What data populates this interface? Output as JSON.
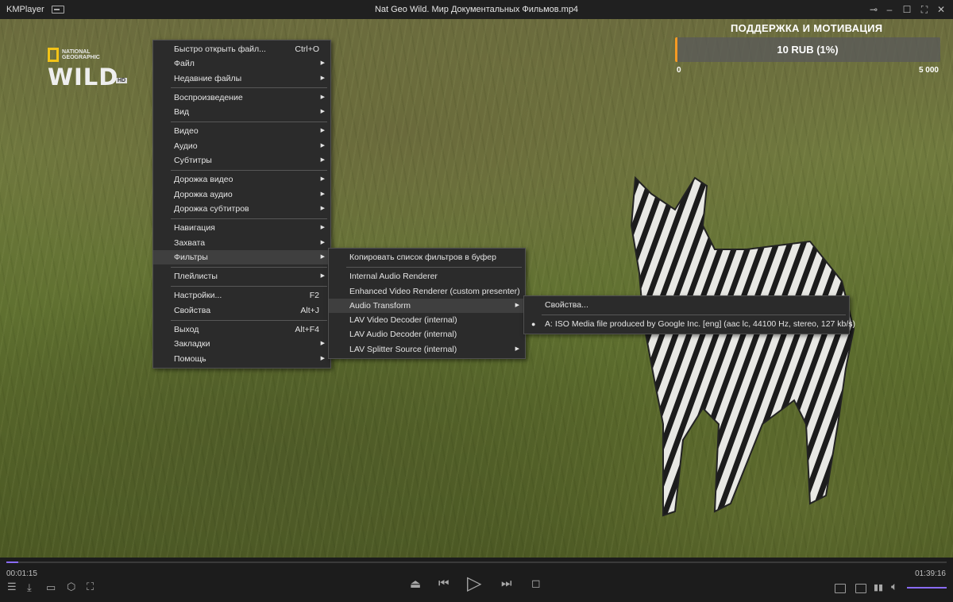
{
  "window": {
    "app_name": "KMPlayer",
    "title": "Nat Geo Wild. Мир Документальных Фильмов.mp4"
  },
  "overlay": {
    "logo_brand": "NATIONAL GEOGRAPHIC",
    "logo_text": "WILD",
    "logo_badge": "HD"
  },
  "donation": {
    "title": "ПОДДЕРЖКА И МОТИВАЦИЯ",
    "value_label": "10 RUB (1%)",
    "progress_fraction": 0.01,
    "min_label": "0",
    "max_label": "5 000"
  },
  "main_menu": {
    "items": [
      {
        "label": "Быстро открыть файл...",
        "shortcut": "Ctrl+O"
      },
      {
        "label": "Файл",
        "submenu": true
      },
      {
        "label": "Недавние файлы",
        "submenu": true
      },
      {
        "label": "Воспроизведение",
        "submenu": true
      },
      {
        "label": "Вид",
        "submenu": true
      },
      {
        "label": "Видео",
        "submenu": true
      },
      {
        "label": "Аудио",
        "submenu": true
      },
      {
        "label": "Субтитры",
        "submenu": true
      },
      {
        "label": "Дорожка видео",
        "submenu": true
      },
      {
        "label": "Дорожка аудио",
        "submenu": true
      },
      {
        "label": "Дорожка субтитров",
        "submenu": true
      },
      {
        "label": "Навигация",
        "submenu": true
      },
      {
        "label": "Захвата",
        "submenu": true
      },
      {
        "label": "Фильтры",
        "submenu": true
      },
      {
        "label": "Плейлисты",
        "submenu": true
      },
      {
        "label": "Настройки...",
        "shortcut": "F2"
      },
      {
        "label": "Свойства",
        "shortcut": "Alt+J"
      },
      {
        "label": "Выход",
        "shortcut": "Alt+F4"
      },
      {
        "label": "Закладки",
        "submenu": true
      },
      {
        "label": "Помощь",
        "submenu": true
      }
    ]
  },
  "filter_menu": {
    "items": [
      {
        "label": "Копировать список фильтров в буфер"
      },
      {
        "label": "Internal Audio Renderer"
      },
      {
        "label": "Enhanced Video Renderer (custom presenter)"
      },
      {
        "label": "Audio Transform",
        "submenu": true
      },
      {
        "label": "LAV Video Decoder (internal)"
      },
      {
        "label": "LAV Audio Decoder (internal)"
      },
      {
        "label": "LAV Splitter Source (internal)",
        "submenu": true
      }
    ]
  },
  "audio_menu": {
    "items": [
      {
        "label": "Свойства..."
      },
      {
        "label": "A: ISO Media file produced by Google Inc. [eng] (aac lc, 44100 Hz, stereo, 127 kb/s)",
        "selected": true
      }
    ]
  },
  "player": {
    "current_time": "00:01:15",
    "total_time": "01:39:16",
    "seek_fraction": 0.0126,
    "volume_fraction": 1.0
  },
  "colors": {
    "accent": "#8a6cff",
    "donation_fill": "#f59a23"
  },
  "icons": {
    "submenu_arrow": "▶",
    "radio_dot": "●"
  }
}
